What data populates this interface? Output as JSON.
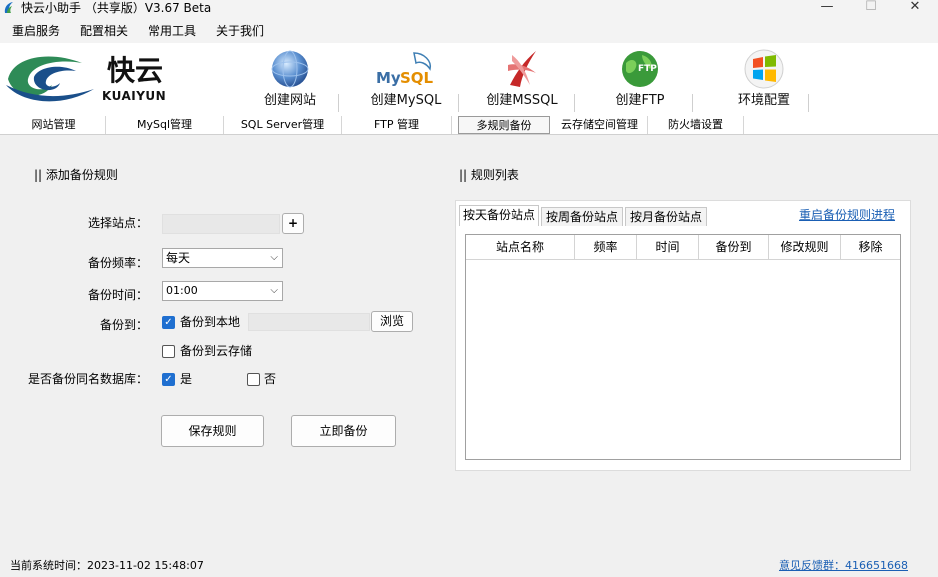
{
  "window": {
    "title": "快云小助手 （共享版）V3.67 Beta",
    "minimize_glyph": "—",
    "maximize_glyph": "☐",
    "close_glyph": "✕"
  },
  "menu": [
    "重启服务",
    "配置相关",
    "常用工具",
    "关于我们"
  ],
  "logo": {
    "cn": "快云",
    "en": "KUAIYUN"
  },
  "toolbar": [
    {
      "label": "创建网站",
      "icon": "globe-icon"
    },
    {
      "label": "创建MySQL",
      "icon": "mysql-dolphin-icon",
      "icon_text": "MySQL"
    },
    {
      "label": "创建MSSQL",
      "icon": "mssql-icon"
    },
    {
      "label": "创建FTP",
      "icon": "ftp-globe-icon",
      "icon_text": "FTP"
    },
    {
      "label": "环境配置",
      "icon": "windows-icon"
    }
  ],
  "main_tabs": [
    "网站管理",
    "MySql管理",
    "SQL Server管理",
    "FTP 管理",
    "多规则备份",
    "云存储空间管理",
    "防火墙设置"
  ],
  "active_main_tab": "多规则备份",
  "left": {
    "section_title": "|| 添加备份规则",
    "site_label": "选择站点：",
    "site_value": "",
    "add_button": "+",
    "freq_label": "备份频率：",
    "freq_value": "每天",
    "time_label": "备份时间：",
    "time_value": "01:00",
    "target_label": "备份到：",
    "local_label": "备份到本地",
    "local_checked": true,
    "local_path": "",
    "browse_button": "浏览",
    "cloud_label": "备份到云存储",
    "cloud_checked": false,
    "db_label": "是否备份同名数据库：",
    "yes_label": "是",
    "yes_checked": true,
    "no_label": "否",
    "no_checked": false,
    "save_button": "保存规则",
    "backup_now_button": "立即备份",
    "chevron": "⌵",
    "check_mark": "✓"
  },
  "right": {
    "section_title": "|| 规则列表",
    "tabs": [
      "按天备份站点",
      "按周备份站点",
      "按月备份站点"
    ],
    "active_tab": "按天备份站点",
    "restart_link": "重启备份规则进程",
    "columns": [
      "站点名称",
      "频率",
      "时间",
      "备份到",
      "修改规则",
      "移除"
    ],
    "rows": []
  },
  "status": {
    "time_text": "当前系统时间：2023-11-02 15:48:07",
    "feedback_link": "意见反馈群：416651668"
  },
  "colors": {
    "accent": "#1f6fd0",
    "link": "#1a5fb4",
    "logo_green": "#2e8b57",
    "logo_blue": "#1a4f8a"
  }
}
